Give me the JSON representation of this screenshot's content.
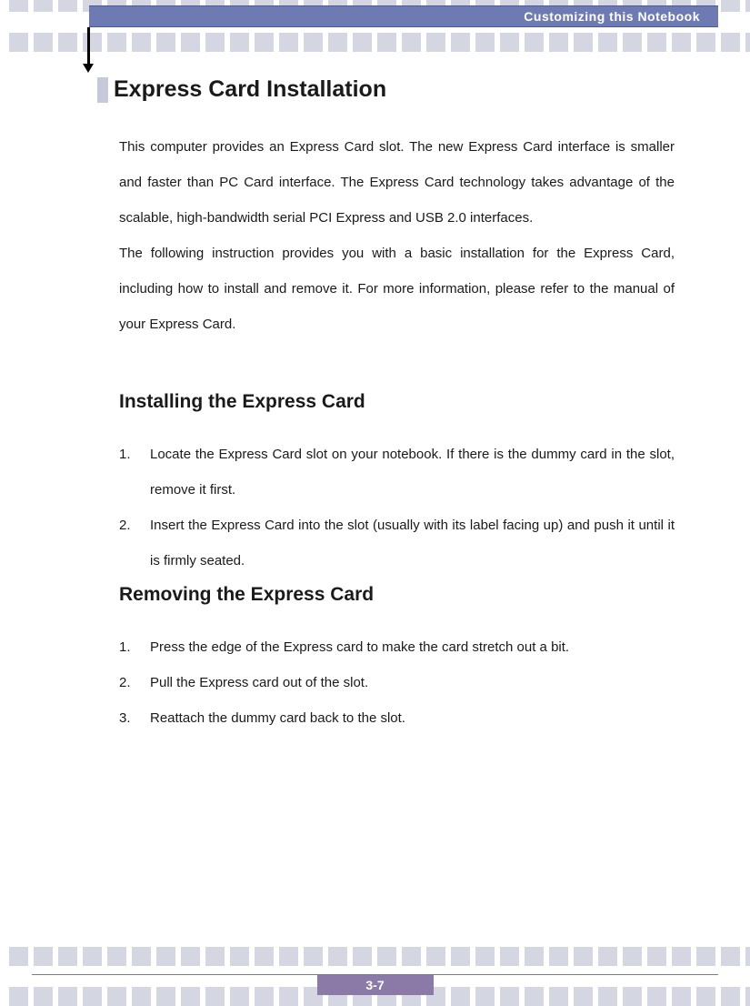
{
  "header": {
    "title": "Customizing this Notebook"
  },
  "main": {
    "heading_a": "Express Card Installation",
    "para_a": "This computer provides an Express Card slot.   The new Express Card interface is smaller and faster than PC Card interface.   The Express Card technology takes advantage of the scalable, high-bandwidth serial PCI Express and USB 2.0 interfaces.",
    "para_b": "The following instruction provides you with a basic installation for the Express Card, including how to install and remove it.   For more information, please refer to the manual of your Express Card.",
    "install": {
      "heading": "Installing the Express Card",
      "items": [
        "Locate the Express Card slot on your notebook.   If there is the dummy card in the slot, remove it first.",
        "Insert the Express Card into the slot (usually with its label facing up) and push it until it is firmly seated."
      ]
    },
    "remove": {
      "heading": "Removing the Express Card",
      "items": [
        "Press the edge of the Express card to make the card stretch out a bit.",
        "Pull the Express card out of the slot.",
        "Reattach the dummy card back to the slot."
      ]
    }
  },
  "footer": {
    "page": "3-7"
  },
  "numbers": [
    "1.",
    "2.",
    "3."
  ]
}
